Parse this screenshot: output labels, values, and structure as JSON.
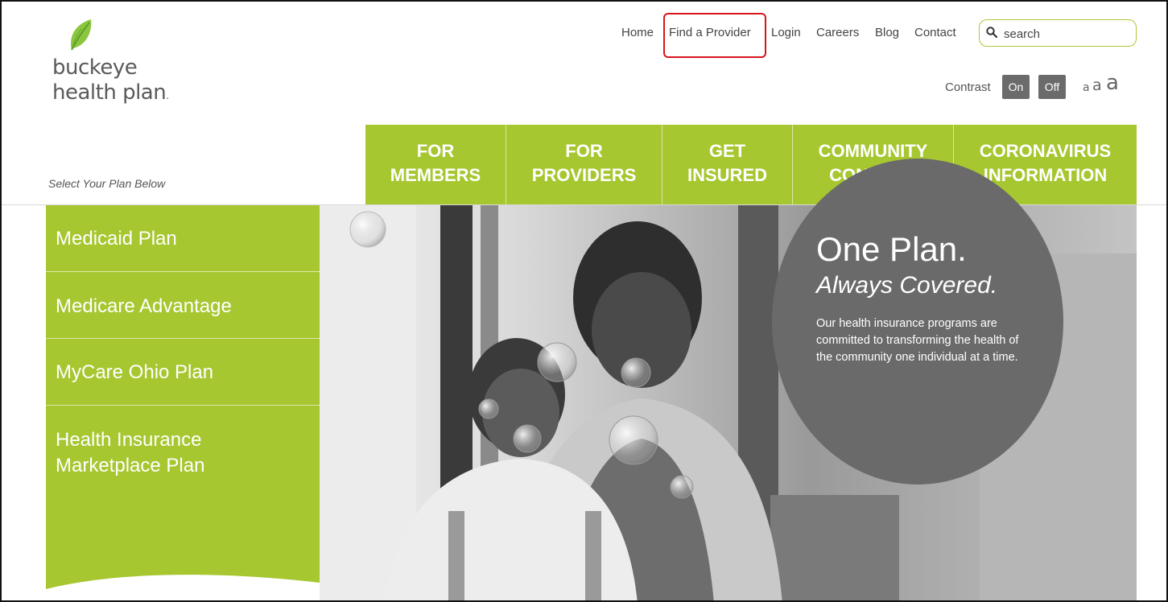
{
  "brand": {
    "line1": "buckeye",
    "line2": "health plan",
    "leaf_icon": "leaf-icon",
    "logo_color": "#5a5a5a",
    "leaf_color": "#7cb342"
  },
  "top_nav": {
    "items": [
      {
        "label": "Home"
      },
      {
        "label": "Find a Provider"
      },
      {
        "label": "Login"
      },
      {
        "label": "Careers"
      },
      {
        "label": "Blog"
      },
      {
        "label": "Contact"
      }
    ],
    "highlighted_item": "Find a Provider",
    "highlight_color": "#d6151c"
  },
  "search": {
    "placeholder": "search",
    "icon": "search-icon"
  },
  "accessibility": {
    "contrast_label": "Contrast",
    "contrast_on": "On",
    "contrast_off": "Off",
    "font_small": "a",
    "font_medium": "a",
    "font_large": "a"
  },
  "main_nav": {
    "items": [
      {
        "line1": "FOR",
        "line2": "MEMBERS"
      },
      {
        "line1": "FOR",
        "line2": "PROVIDERS"
      },
      {
        "line1": "GET",
        "line2": "INSURED"
      },
      {
        "line1": "COMMUNITY",
        "line2": "CONNECT"
      },
      {
        "line1": "CORONAVIRUS",
        "line2": "INFORMATION"
      }
    ],
    "background": "#a6c730"
  },
  "select_plan_label": "Select Your Plan Below",
  "sidebar": {
    "items": [
      {
        "line1": "Medicaid Plan",
        "line2": ""
      },
      {
        "line1": "Medicare Advantage",
        "line2": ""
      },
      {
        "line1": "MyCare Ohio Plan",
        "line2": ""
      },
      {
        "line1": "Health Insurance",
        "line2": "Marketplace Plan"
      }
    ]
  },
  "hero": {
    "heading": "One Plan.",
    "subheading": "Always Covered.",
    "body": "Our health insurance programs are committed to transforming the health of the community one individual at a time.",
    "circle_color": "#6a6a6a"
  }
}
